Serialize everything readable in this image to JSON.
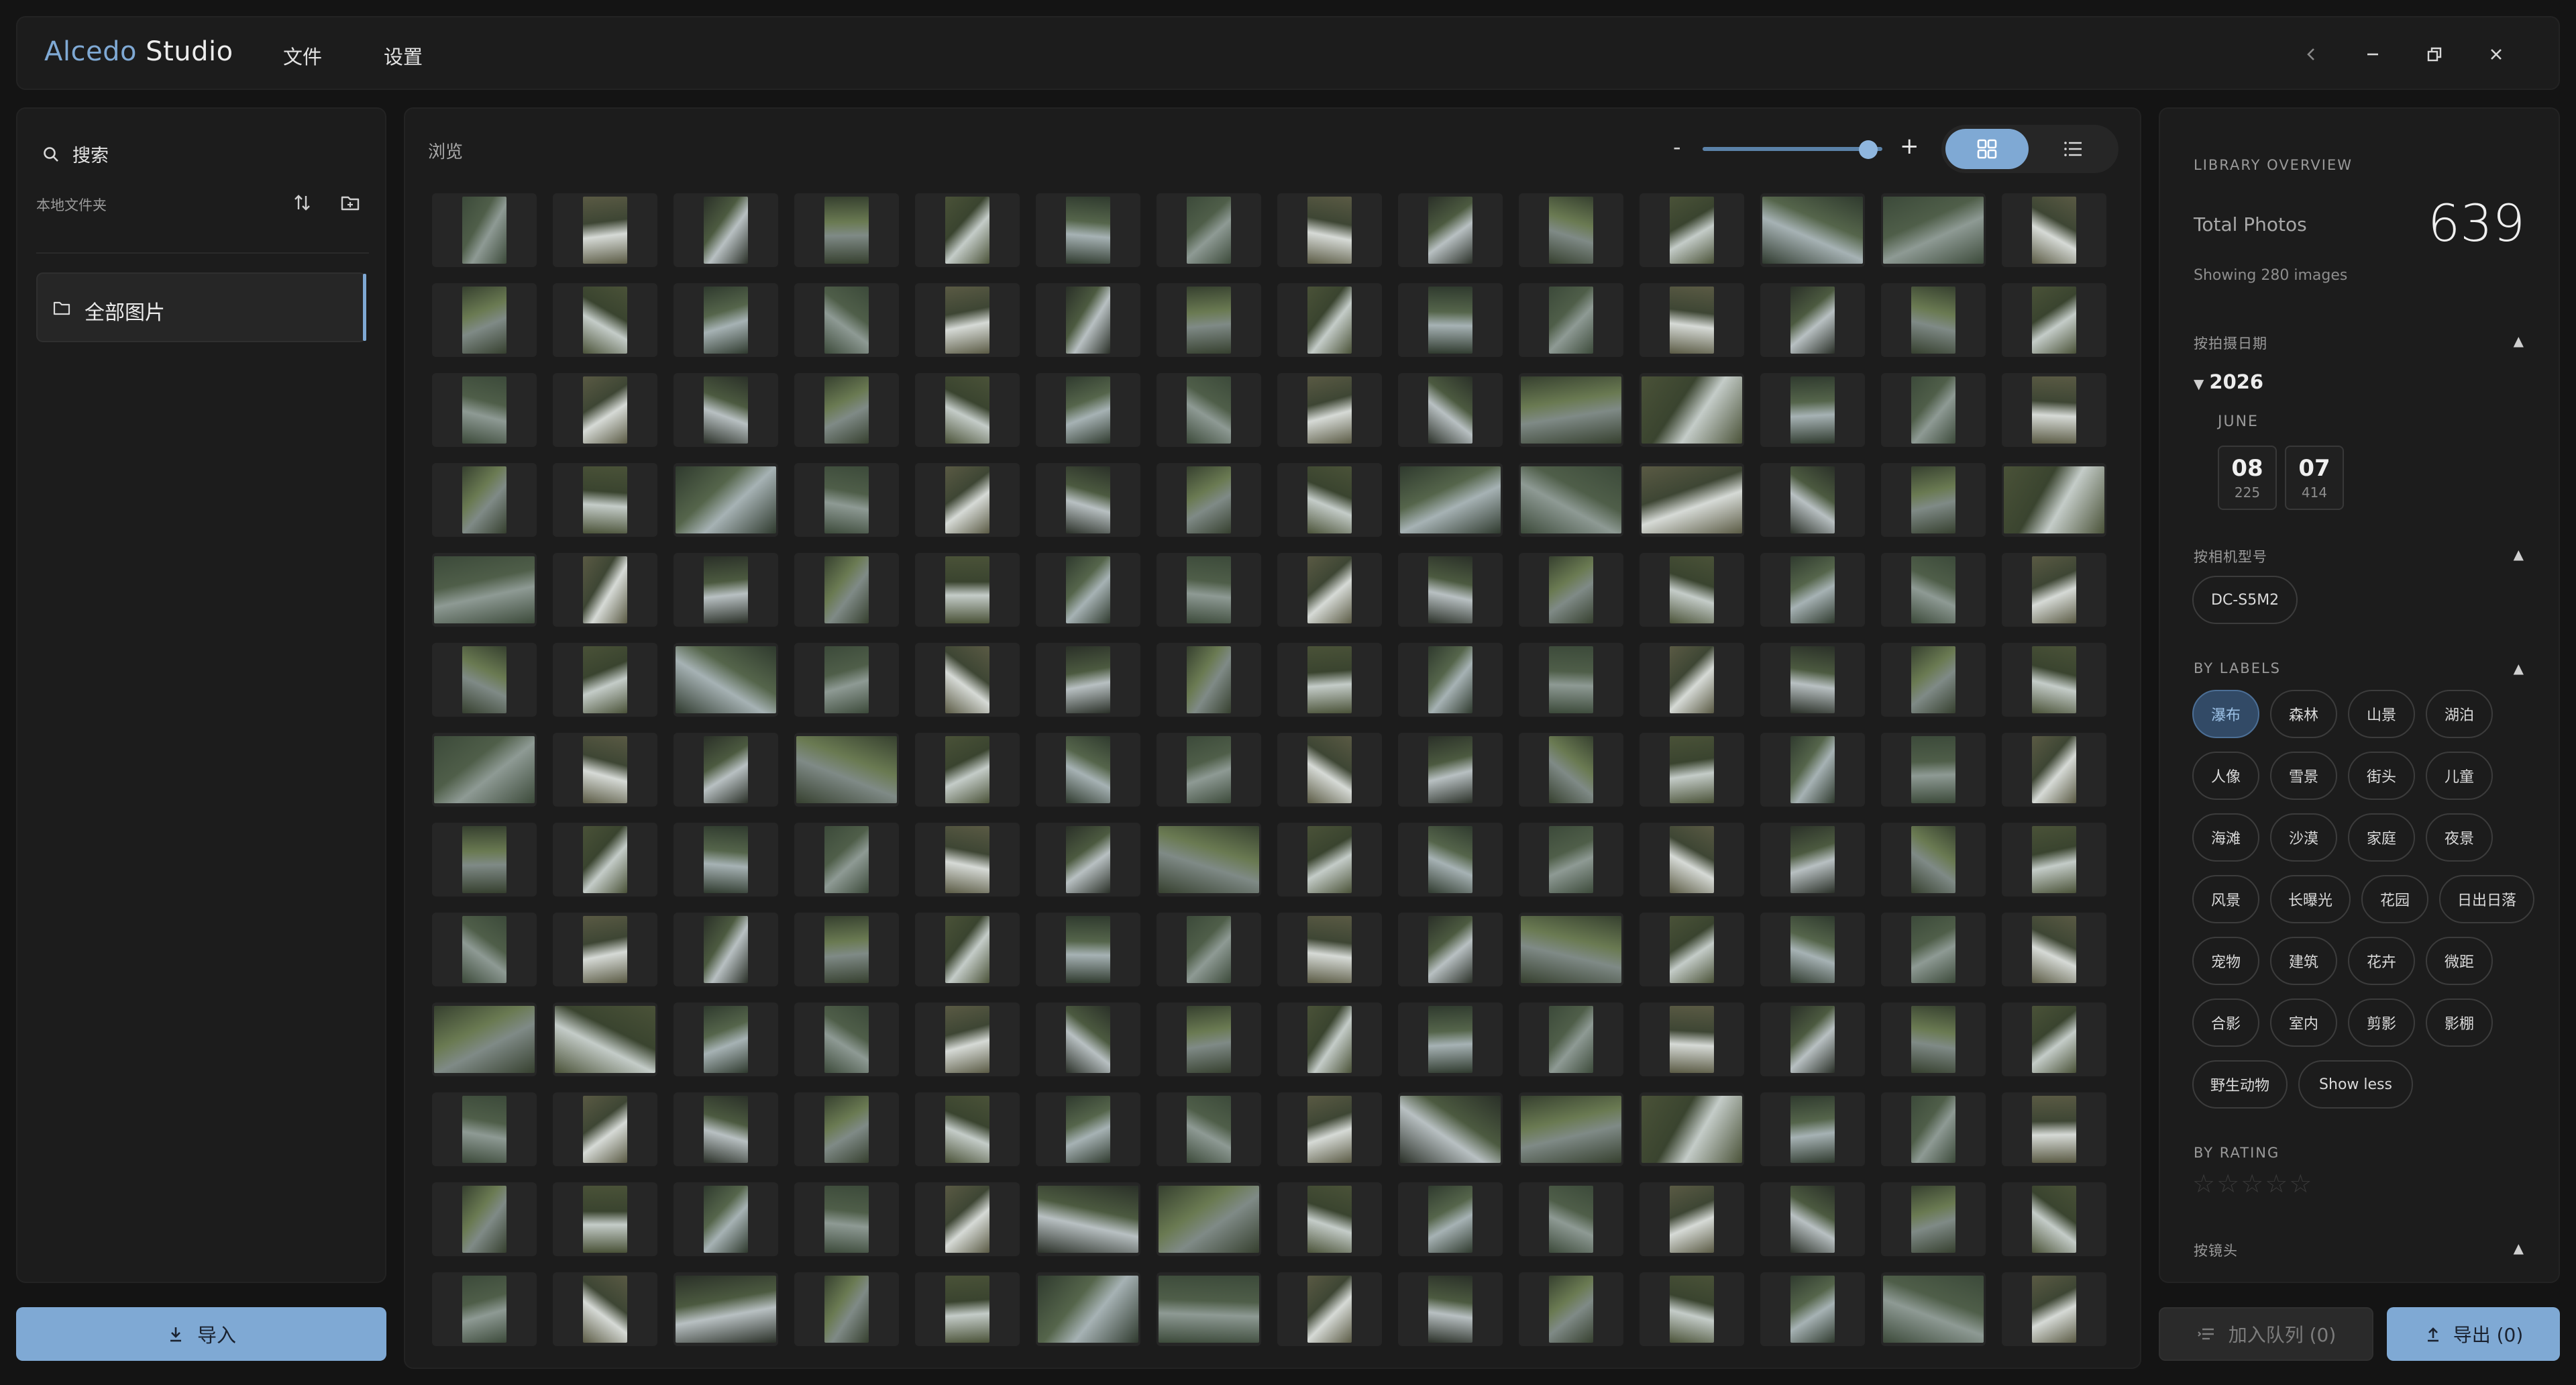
{
  "app": {
    "title_part1": "Alcedo",
    "title_part2": "Studio"
  },
  "menu": {
    "file": "文件",
    "settings": "设置"
  },
  "sidebar": {
    "search_placeholder": "搜索",
    "folder_section_label": "本地文件夹",
    "folders": [
      {
        "label": "全部图片",
        "active": true
      }
    ],
    "import_label": "导入"
  },
  "main": {
    "browse_label": "浏览",
    "zoom": {
      "minus": "-",
      "plus": "+",
      "level": 0.92
    },
    "view_mode": "grid",
    "colors": {
      "accent": "#7fa9d4",
      "tile_bg": "#262626"
    },
    "thumbnails": [
      [
        "p",
        "p",
        "p",
        "p",
        "p",
        "p",
        "p",
        "p",
        "p",
        "p",
        "p",
        "l",
        "l",
        "p"
      ],
      [
        "p",
        "p",
        "p",
        "p",
        "p",
        "p",
        "p",
        "p",
        "p",
        "p",
        "p",
        "p",
        "p",
        "p"
      ],
      [
        "p",
        "p",
        "p",
        "p",
        "p",
        "p",
        "p",
        "p",
        "p",
        "l",
        "l",
        "p",
        "p",
        "p"
      ],
      [
        "p",
        "p",
        "l",
        "p",
        "p",
        "p",
        "p",
        "p",
        "l",
        "l",
        "l",
        "p",
        "p",
        "l"
      ],
      [
        "l",
        "p",
        "p",
        "p",
        "p",
        "p",
        "p",
        "p",
        "p",
        "p",
        "p",
        "p",
        "p",
        "p"
      ],
      [
        "p",
        "p",
        "l",
        "p",
        "p",
        "p",
        "p",
        "p",
        "p",
        "p",
        "p",
        "p",
        "p",
        "p"
      ],
      [
        "l",
        "p",
        "p",
        "l",
        "p",
        "p",
        "p",
        "p",
        "p",
        "p",
        "p",
        "p",
        "p",
        "p"
      ],
      [
        "p",
        "p",
        "p",
        "p",
        "p",
        "p",
        "l",
        "p",
        "p",
        "p",
        "p",
        "p",
        "p",
        "p"
      ],
      [
        "p",
        "p",
        "p",
        "p",
        "p",
        "p",
        "p",
        "p",
        "p",
        "l",
        "p",
        "p",
        "p",
        "p"
      ],
      [
        "l",
        "l",
        "p",
        "p",
        "p",
        "p",
        "p",
        "p",
        "p",
        "p",
        "p",
        "p",
        "p",
        "p"
      ],
      [
        "p",
        "p",
        "p",
        "p",
        "p",
        "p",
        "p",
        "p",
        "l",
        "l",
        "l",
        "p",
        "p",
        "p"
      ],
      [
        "p",
        "p",
        "p",
        "p",
        "p",
        "l",
        "l",
        "p",
        "p",
        "p",
        "p",
        "p",
        "p",
        "p"
      ],
      [
        "p",
        "p",
        "l",
        "p",
        "p",
        "l",
        "l",
        "p",
        "p",
        "p",
        "p",
        "p",
        "l",
        "p"
      ]
    ]
  },
  "overview": {
    "title": "LIBRARY OVERVIEW",
    "total_label": "Total Photos",
    "total_value": "639",
    "showing": "Showing 280 images",
    "by_date_label": "按拍摄日期",
    "year": "2026",
    "month": "JUNE",
    "days": [
      {
        "day": "08",
        "count": "225"
      },
      {
        "day": "07",
        "count": "414"
      }
    ],
    "by_camera_label": "按相机型号",
    "cameras": [
      "DC-S5M2"
    ],
    "by_labels_label": "BY LABELS",
    "labels": [
      "瀑布",
      "森林",
      "山景",
      "湖泊",
      "人像",
      "雪景",
      "街头",
      "儿童",
      "海滩",
      "沙漠",
      "家庭",
      "夜景",
      "风景",
      "长曝光",
      "花园",
      "日出日落",
      "宠物",
      "建筑",
      "花卉",
      "微距",
      "合影",
      "室内",
      "剪影",
      "影棚",
      "野生动物",
      "Show less"
    ],
    "active_label": "瀑布",
    "by_rating_label": "BY RATING",
    "rating": 0,
    "rating_stars": "☆☆☆☆☆",
    "by_lens_label": "按镜头",
    "caret": "▲",
    "year_caret": "▼"
  },
  "footer": {
    "queue_label": "加入队列 (0)",
    "export_label": "导出 (0)"
  }
}
